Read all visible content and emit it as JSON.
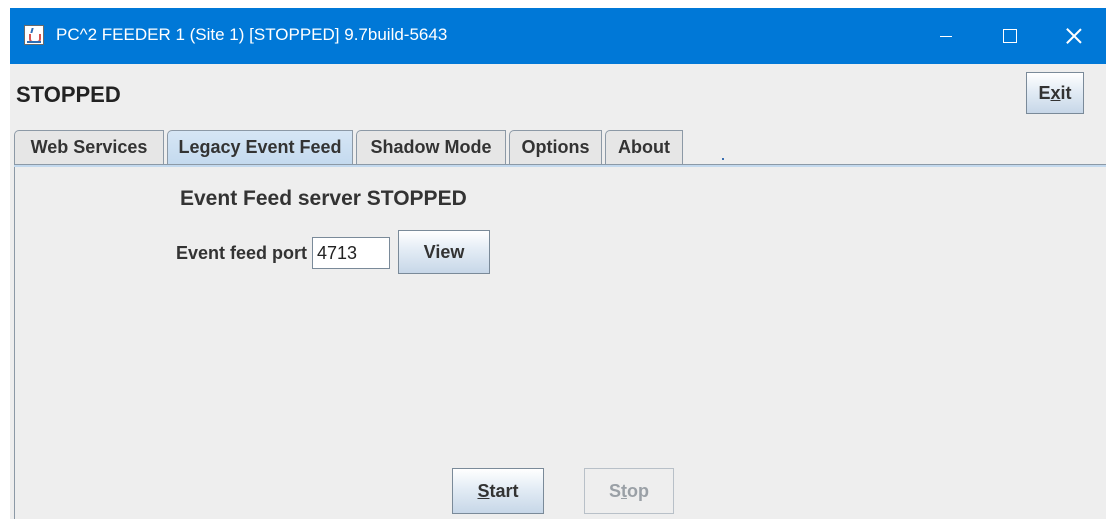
{
  "window": {
    "title": "PC^2 FEEDER 1 (Site 1) [STOPPED] 9.7build-5643",
    "icon": "java-cup-icon"
  },
  "header": {
    "status": "STOPPED",
    "exit_label": "Exit",
    "exit_mnemonic_pre": "E",
    "exit_mnemonic": "x",
    "exit_mnemonic_post": "it"
  },
  "tabs": [
    {
      "label": "Web Services",
      "active": false
    },
    {
      "label": "Legacy Event Feed",
      "active": true
    },
    {
      "label": "Shadow Mode",
      "active": false
    },
    {
      "label": "Options",
      "active": false
    },
    {
      "label": "About",
      "active": false
    }
  ],
  "main": {
    "server_status": "Event Feed server STOPPED",
    "port_label": "Event feed port",
    "port_value": "4713",
    "view_label": "View"
  },
  "footer": {
    "start_mnemonic": "S",
    "start_rest": "tart",
    "stop_pre": "S",
    "stop_mnemonic": "t",
    "stop_rest": "op",
    "stop_enabled": false
  },
  "colors": {
    "titlebar": "#0078d7",
    "window_bg": "#eeeeee",
    "active_tab": "#c3d9ee"
  }
}
